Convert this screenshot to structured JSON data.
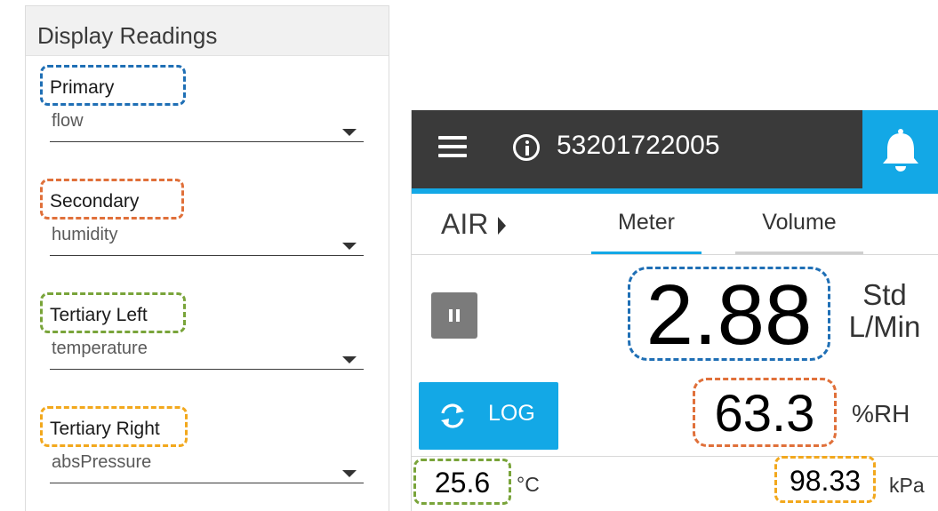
{
  "colors": {
    "primary_outline": "#1f6fb5",
    "secondary_outline": "#e0703a",
    "tertiary_left_outline": "#79a43a",
    "tertiary_right_outline": "#f2a81d",
    "accent": "#13a8e6",
    "topbar": "#3a3a3a"
  },
  "settings": {
    "title": "Display Readings",
    "fields": [
      {
        "label": "Primary",
        "value": "flow"
      },
      {
        "label": "Secondary",
        "value": "humidity"
      },
      {
        "label": "Tertiary Left",
        "value": "temperature"
      },
      {
        "label": "Tertiary Right",
        "value": "absPressure"
      }
    ]
  },
  "device": {
    "header": {
      "menu_icon": "hamburger-menu-icon",
      "info_icon": "info-circle-icon",
      "device_id": "53201722005",
      "bell_icon": "bell-icon"
    },
    "gas": "AIR",
    "tabs": [
      {
        "label": "Meter",
        "active": true
      },
      {
        "label": "Volume",
        "active": false
      }
    ],
    "primary": {
      "value": "2.88",
      "unit_line1": "Std",
      "unit_line2": "L/Min"
    },
    "secondary": {
      "value": "63.3",
      "unit": "%RH"
    },
    "log_button": {
      "label": "LOG",
      "icon": "refresh-icon"
    },
    "tertiary_left": {
      "value": "25.6",
      "unit": "°C"
    },
    "tertiary_right": {
      "value": "98.33",
      "unit": "kPa"
    }
  }
}
